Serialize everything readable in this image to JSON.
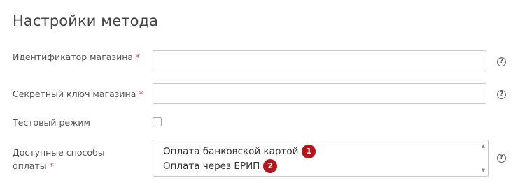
{
  "section": {
    "title": "Настройки метода"
  },
  "fields": {
    "shop_id": {
      "label": "Идентификатор магазина",
      "required_mark": "*",
      "value": "",
      "help_icon": "help-circle-icon"
    },
    "secret_key": {
      "label": "Секретный ключ магазина",
      "required_mark": "*",
      "value": "",
      "help_icon": "help-circle-icon"
    },
    "test_mode": {
      "label": "Тестовый режим",
      "checked": false
    },
    "payment_methods": {
      "label_line1": "Доступные способы",
      "label_line2": "оплаты",
      "required_mark": "*",
      "options": [
        {
          "label": "Оплата банковской картой",
          "badge": "1"
        },
        {
          "label": "Оплата через ЕРИП",
          "badge": "2"
        }
      ],
      "help_icon": "help-circle-icon"
    }
  },
  "help_glyph": "?",
  "colors": {
    "required": "#d9534f",
    "badge": "#b5141b"
  }
}
